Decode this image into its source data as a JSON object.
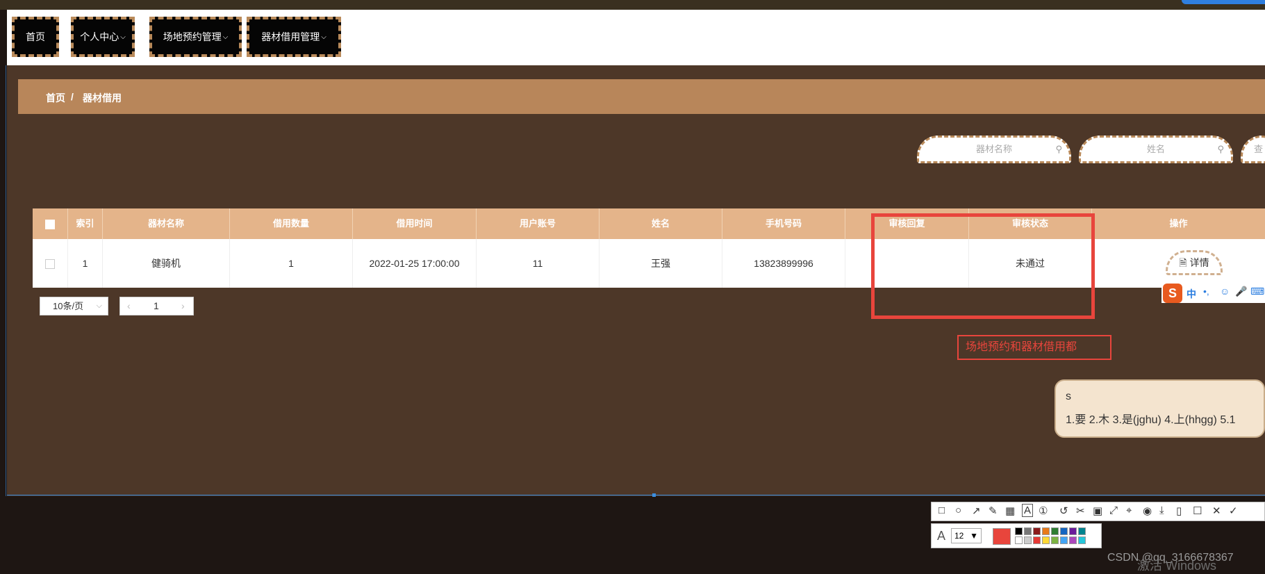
{
  "nav": {
    "items": [
      {
        "label": "首页",
        "has_menu": false
      },
      {
        "label": "个人中心",
        "has_menu": true
      },
      {
        "label": "场地预约管理",
        "has_menu": true
      },
      {
        "label": "器材借用管理",
        "has_menu": true
      }
    ]
  },
  "breadcrumb": {
    "home": "首页",
    "separator": "/",
    "current": "器材借用"
  },
  "search": {
    "equipment_placeholder": "器材名称",
    "name_placeholder": "姓名",
    "query_button_partial": "查"
  },
  "table": {
    "columns": [
      "索引",
      "器材名称",
      "借用数量",
      "借用时间",
      "用户账号",
      "姓名",
      "手机号码",
      "审核回复",
      "审核状态",
      "操作"
    ],
    "rows": [
      {
        "index": "1",
        "equipment": "健骑机",
        "quantity": "1",
        "borrow_time": "2022-01-25 17:00:00",
        "account": "11",
        "name": "王强",
        "phone": "13823899996",
        "review_reply": "",
        "review_status": "未通过",
        "action": "详情"
      }
    ]
  },
  "pagination": {
    "page_size": "10条/页",
    "current_page": "1",
    "prev": "‹",
    "next": "›"
  },
  "annotation": {
    "text": "场地预约和器材借用都"
  },
  "ime": {
    "logo": "S",
    "mode": "中",
    "typed": "s",
    "candidates": "1.要  2.木  3.是(jghu)  4.上(hhgg)  5.1"
  },
  "screenshot_toolbar": {
    "font_label": "A",
    "font_size": "12",
    "accent_color": "#e8453c"
  },
  "watermark": "CSDN @qq_3166678367",
  "activation": "激活 Windows",
  "colors": {
    "nav_bg": "#050505",
    "main_bg": "#4d3728",
    "breadcrumb_bg": "#b8865a",
    "header_bg": "#e4b48a",
    "annotation": "#e8453c"
  }
}
